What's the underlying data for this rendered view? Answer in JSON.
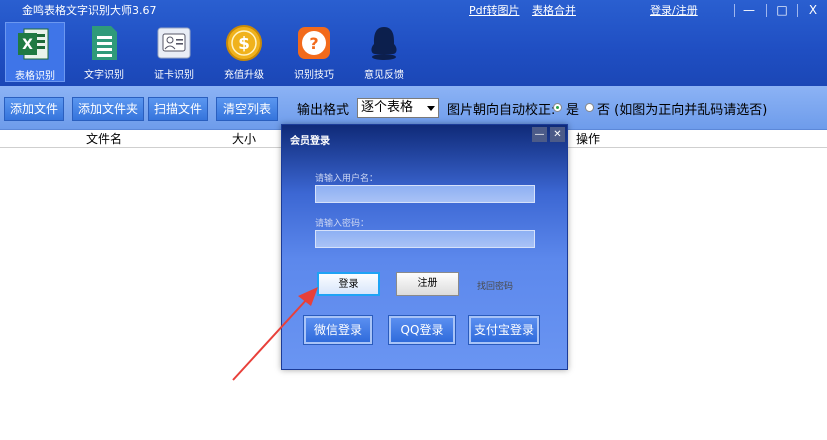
{
  "app": {
    "title": "金鸣表格文字识别大师3.67",
    "links": {
      "pdf_to_image": "Pdf转图片",
      "table_merge": "表格合并",
      "login_register": "登录/注册"
    },
    "window_controls": {
      "minimize": "—",
      "maximize": "□",
      "close": "X"
    }
  },
  "nav": {
    "items": [
      {
        "label": "表格识别",
        "icon": "excel-icon",
        "active": true
      },
      {
        "label": "文字识别",
        "icon": "document-icon"
      },
      {
        "label": "证卡识别",
        "icon": "id-card-icon"
      },
      {
        "label": "充值升级",
        "icon": "coin-icon"
      },
      {
        "label": "识别技巧",
        "icon": "help-icon"
      },
      {
        "label": "意见反馈",
        "icon": "feedback-icon"
      }
    ]
  },
  "toolbar": {
    "add_file": "添加文件",
    "add_folder": "添加文件夹",
    "scan_file": "扫描文件",
    "clear_list": "清空列表",
    "output_format_label": "输出格式",
    "output_format_value": "逐个表格",
    "auto_orient_label": "图片朝向自动校正:",
    "option_yes": "是",
    "option_no": "否 (如图为正向并乱码请选否)"
  },
  "table": {
    "columns": {
      "filename": "文件名",
      "size": "大小",
      "action": "操作"
    }
  },
  "dialog": {
    "title": "会员登录",
    "username_label": "请输入用户名：",
    "password_label": "请输入密码：",
    "login": "登录",
    "register": "注册",
    "forgot_password": "找回密码",
    "wechat_login": "微信登录",
    "qq_login": "QQ登录",
    "alipay_login": "支付宝登录"
  },
  "colors": {
    "header": "#1f4ec2",
    "toolbar": "#7aa6ef",
    "annotation_arrow": "#e8403a"
  }
}
